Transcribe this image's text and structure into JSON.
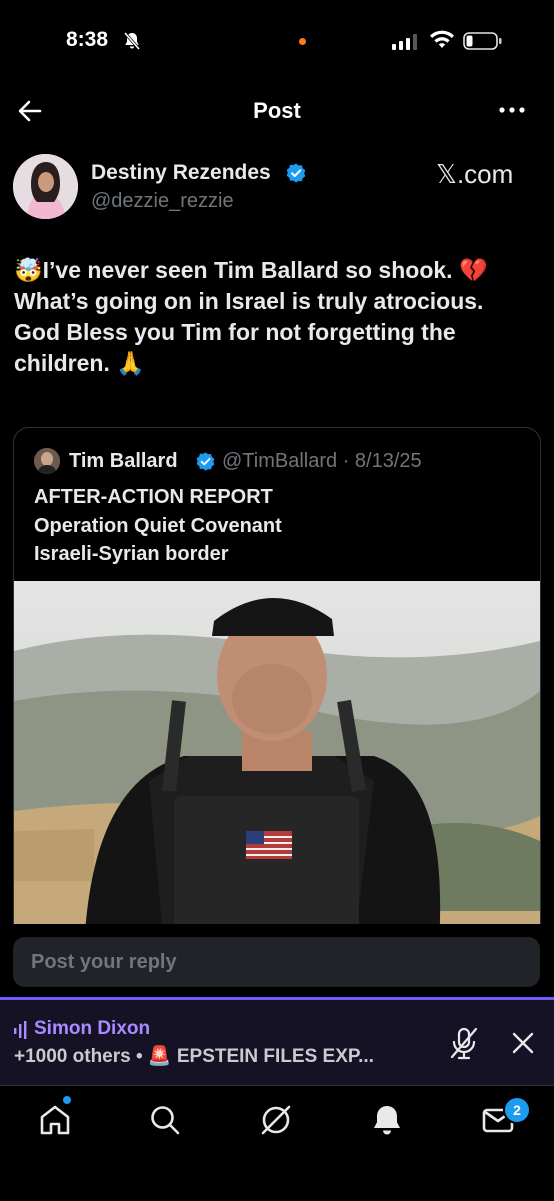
{
  "status_bar": {
    "time": "8:38"
  },
  "header": {
    "title": "Post"
  },
  "post": {
    "author_name": "Destiny Rezendes",
    "author_handle": "@dezzie_rezzie",
    "source": "𝕏.com",
    "text_lines": [
      "🤯I’ve never seen Tim Ballard so shook. 💔",
      "What’s going on in Israel is truly atrocious.",
      "God Bless you Tim for not forgetting the",
      "children. 🙏"
    ]
  },
  "quote": {
    "author_name": "Tim Ballard",
    "author_handle": "@TimBallard · 8/13/25",
    "lines": [
      "AFTER-ACTION REPORT",
      "Operation Quiet Covenant",
      "Israeli-Syrian border"
    ]
  },
  "reply": {
    "placeholder": "Post your reply"
  },
  "spaces": {
    "host": "Simon Dixon",
    "subtitle": "+1000 others • 🚨 EPSTEIN FILES EXP..."
  },
  "tabbar": {
    "messages_badge": "2"
  },
  "colors": {
    "accent": "#1d9bf0",
    "spaces": "#7856ff",
    "background": "#000000"
  }
}
